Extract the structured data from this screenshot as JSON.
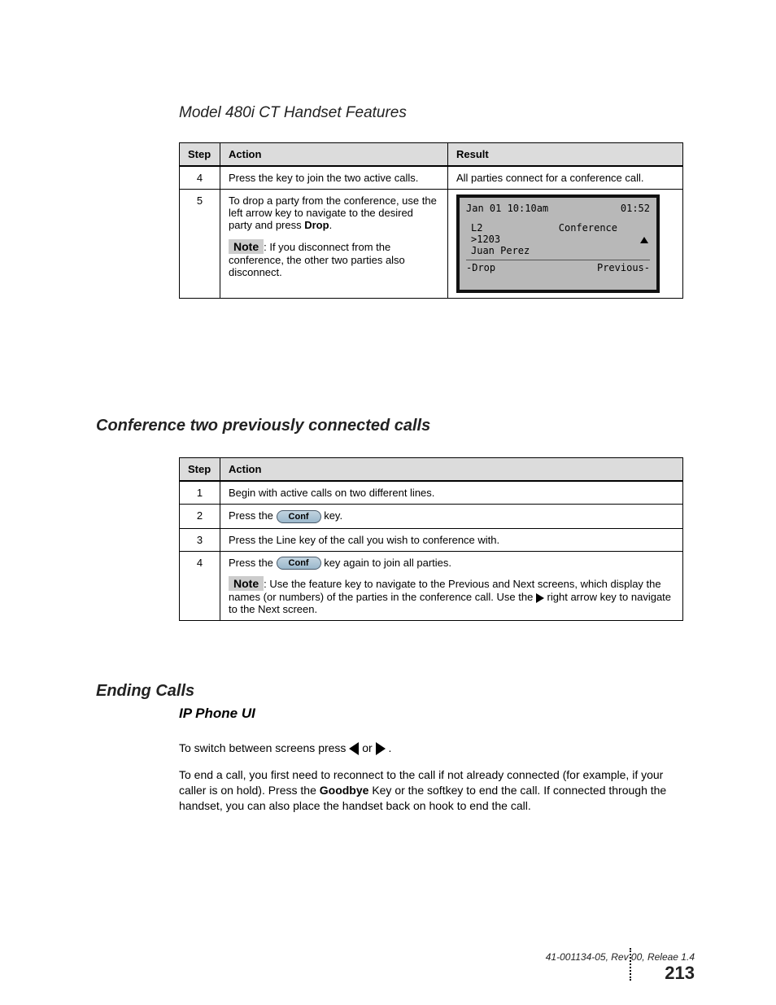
{
  "section_title_prefix": "Model 480i CT Handset ",
  "section_title": "Features",
  "table1": {
    "headers": {
      "step": "Step",
      "action": "Action",
      "result": "Result"
    },
    "rows": [
      {
        "step": "4",
        "action": "Press the key to join the two active calls.",
        "result": "All parties connect for a conference call."
      },
      {
        "step": "5",
        "action_lead": "To drop a party from the conference, use the left arrow key to navigate to the desired party and press",
        "action_bold": "Drop",
        "note_label": "Note",
        "note_text": ": If you disconnect from the conference, the other two parties also disconnect.",
        "lcd": {
          "line1_left": "Jan 01 10:10am",
          "line1_right": "01:52",
          "line2_left": "L2",
          "line2_right": "Conference",
          "line3": ">1203",
          "line4": "Juan Perez",
          "soft_left": "-Drop",
          "soft_right": "Previous-"
        }
      }
    ]
  },
  "conf_two_heading": "Conference two previously connected calls",
  "table2": {
    "headers": {
      "step": "Step",
      "action": "Action"
    },
    "rows": [
      {
        "step": "1",
        "action": "Begin with active calls on two different lines."
      },
      {
        "step": "2",
        "action_pre": "Press the ",
        "btn": "Conf",
        "action_post": " key."
      },
      {
        "step": "3",
        "action": "Press the Line key of the call you wish to conference with."
      },
      {
        "step": "4",
        "action_pre": "Press the ",
        "btn": "Conf",
        "action_post": " key again to join all parties.",
        "note_label": "Note",
        "note_text_a": ": Use the feature key to navigate to the Previous and Next screens, which display the names (or numbers) of the parties in the conference call. Use the",
        "note_text_b": " right arrow key to navigate to the Next screen."
      }
    ]
  },
  "ending_heading": "Ending Calls",
  "ending_sub": "IP Phone UI",
  "ending_para1_a": "To end a call, you first need to reconnect to the call if not already connected (for example, if your caller is on hold). Press the ",
  "ending_para1_b": "Goodbye",
  "ending_para1_c": " Key or the softkey to end the call. If connected through the handset, you can also place the handset back on hook to end the call.",
  "ending_para2_a": "To switch between screens press ",
  "ending_para2_b": " or ",
  "ending_para2_c": ".",
  "footer": {
    "line1": "41-001134-05, Rev 00, Releae 1.4",
    "page": "213"
  }
}
